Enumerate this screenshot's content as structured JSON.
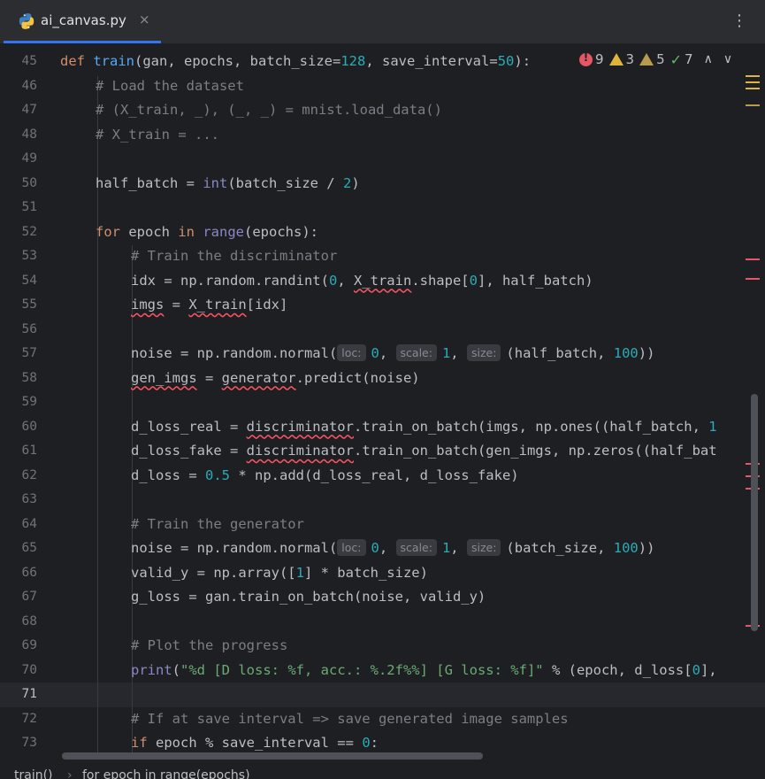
{
  "tab": {
    "filename": "ai_canvas.py",
    "close_glyph": "×",
    "icon": "python-icon"
  },
  "menu": {
    "glyph": "⋮"
  },
  "inspections": {
    "errors": "9",
    "warnings": "3",
    "weak_warnings": "5",
    "typos": "7",
    "up": "∧",
    "down": "∨"
  },
  "lines": [
    {
      "n": "45"
    },
    {
      "n": "46"
    },
    {
      "n": "47"
    },
    {
      "n": "48"
    },
    {
      "n": "49"
    },
    {
      "n": "50"
    },
    {
      "n": "51"
    },
    {
      "n": "52"
    },
    {
      "n": "53"
    },
    {
      "n": "54"
    },
    {
      "n": "55"
    },
    {
      "n": "56"
    },
    {
      "n": "57"
    },
    {
      "n": "58"
    },
    {
      "n": "59"
    },
    {
      "n": "60"
    },
    {
      "n": "61"
    },
    {
      "n": "62"
    },
    {
      "n": "63"
    },
    {
      "n": "64"
    },
    {
      "n": "65"
    },
    {
      "n": "66"
    },
    {
      "n": "67"
    },
    {
      "n": "68"
    },
    {
      "n": "69"
    },
    {
      "n": "70"
    },
    {
      "n": "71"
    },
    {
      "n": "72"
    },
    {
      "n": "73"
    }
  ],
  "code": {
    "l45": [
      "def",
      "train",
      "(gan, epochs, ",
      "batch_size",
      "=",
      "128",
      ", ",
      "save_interval",
      "=",
      "50",
      "):"
    ],
    "l46": "# Load the dataset",
    "l47": "# (X_train, _), (_, _) = mnist.load_data()",
    "l48": "# X_train = ...",
    "l50": [
      "half_batch = ",
      "int",
      "(batch_size / ",
      "2",
      ")"
    ],
    "l52": [
      "for",
      " epoch ",
      "in",
      " ",
      "range",
      "(epochs):"
    ],
    "l53": "# Train the discriminator",
    "l54": [
      "idx = np.random.randint(",
      "0",
      ", ",
      "X_train",
      ".shape[",
      "0",
      "], half_batch)"
    ],
    "l55": [
      "imgs",
      " = ",
      "X_train",
      "[idx]"
    ],
    "l57": [
      "noise = np.random.normal(",
      "loc:",
      "0",
      ", ",
      "scale:",
      "1",
      ", ",
      "size:",
      "(half_batch, ",
      "100",
      "))"
    ],
    "l58": [
      "gen_imgs",
      " = ",
      "generator",
      ".predict(noise)"
    ],
    "l60": [
      "d_loss_real = ",
      "discriminator",
      ".train_on_batch(imgs, np.ones((half_batch, ",
      "1"
    ],
    "l61": [
      "d_loss_fake = ",
      "discriminator",
      ".train_on_batch(gen_imgs, np.zeros((half_bat"
    ],
    "l62": [
      "d_loss = ",
      "0.5",
      " * np.add(d_loss_real, d_loss_fake)"
    ],
    "l64": "# Train the generator",
    "l65": [
      "noise = np.random.normal(",
      "loc:",
      "0",
      ", ",
      "scale:",
      "1",
      ", ",
      "size:",
      "(batch_size, ",
      "100",
      "))"
    ],
    "l66": [
      "valid_y = np.array([",
      "1",
      "] * batch_size)"
    ],
    "l67": "g_loss = gan.train_on_batch(noise, valid_y)",
    "l69": "# Plot the progress",
    "l70": [
      "print",
      "(",
      "\"%d [D loss: %f, acc.: %.2f%%] [G loss: %f]\"",
      " % (epoch, d_loss[",
      "0",
      "], "
    ],
    "l72": "# If at save interval => save generated image samples",
    "l73": [
      "if",
      " epoch % save_interval == ",
      "0",
      ":"
    ]
  },
  "breadcrumb": {
    "fn": "train()",
    "sep": "›",
    "loop": "for epoch in range(epochs)"
  },
  "colors": {
    "accent": "#3574f0",
    "error": "#e55765",
    "warning": "#e0b33a"
  }
}
